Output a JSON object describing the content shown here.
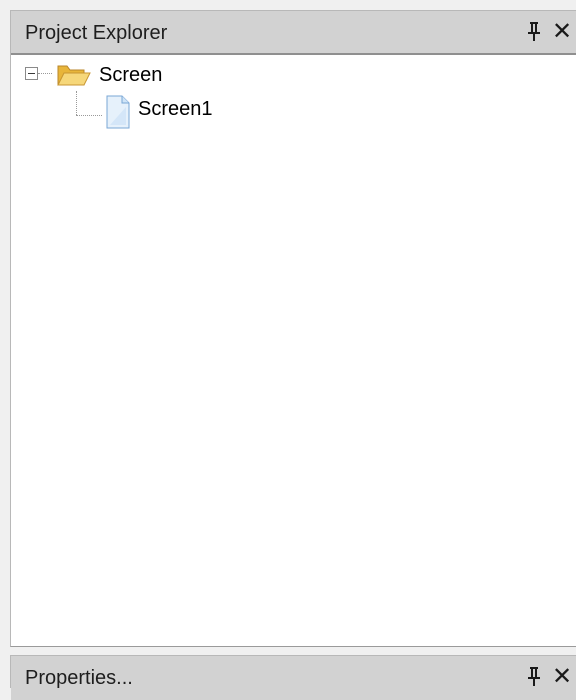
{
  "explorer": {
    "title": "Project Explorer",
    "pin_icon": "pin-icon",
    "close_icon": "close-icon",
    "close_glyph": "✕",
    "tree": {
      "root": {
        "label": "Screen",
        "expanded": true,
        "icon": "folder-open-icon",
        "children": [
          {
            "label": "Screen1",
            "icon": "file-icon"
          }
        ]
      }
    }
  },
  "properties": {
    "title": "Properties...",
    "pin_icon": "pin-icon",
    "close_icon": "close-icon",
    "close_glyph": "✕"
  },
  "colors": {
    "titlebar_bg": "#d2d2d2",
    "panel_bg": "#ffffff",
    "window_bg": "#f0f0f0",
    "folder_yellow": "#f2c94c",
    "file_blue": "#cfe4f7"
  }
}
